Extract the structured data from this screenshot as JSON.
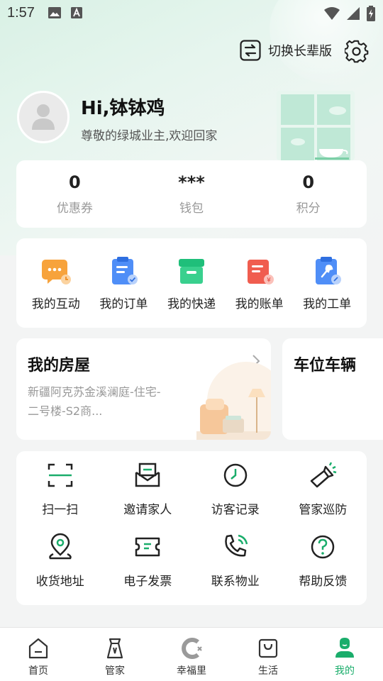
{
  "status_bar": {
    "time": "1:57"
  },
  "header": {
    "switch_label": "切换长辈版"
  },
  "profile": {
    "greeting": "Hi,钵钵鸡",
    "welcome": "尊敬的绿城业主,欢迎回家"
  },
  "stats": [
    {
      "value": "0",
      "label": "优惠券"
    },
    {
      "value": "***",
      "label": "钱包"
    },
    {
      "value": "0",
      "label": "积分"
    }
  ],
  "orders": [
    {
      "label": "我的互动",
      "icon": "chat-icon"
    },
    {
      "label": "我的订单",
      "icon": "order-icon"
    },
    {
      "label": "我的快递",
      "icon": "package-icon"
    },
    {
      "label": "我的账单",
      "icon": "bill-icon"
    },
    {
      "label": "我的工单",
      "icon": "work-order-icon"
    }
  ],
  "house": {
    "title": "我的房屋",
    "address": "新疆阿克苏金溪澜庭-住宅-二号楼-S2商..."
  },
  "vehicle": {
    "title": "车位车辆"
  },
  "services": [
    {
      "label": "扫一扫",
      "icon": "scan-icon"
    },
    {
      "label": "邀请家人",
      "icon": "invite-icon"
    },
    {
      "label": "访客记录",
      "icon": "visitor-clock-icon"
    },
    {
      "label": "管家巡防",
      "icon": "flashlight-icon"
    },
    {
      "label": "收货地址",
      "icon": "location-pin-icon"
    },
    {
      "label": "电子发票",
      "icon": "ticket-icon"
    },
    {
      "label": "联系物业",
      "icon": "phone-icon"
    },
    {
      "label": "帮助反馈",
      "icon": "help-icon"
    }
  ],
  "bottom_nav": [
    {
      "label": "首页",
      "icon": "home-icon"
    },
    {
      "label": "管家",
      "icon": "butler-icon"
    },
    {
      "label": "幸福里",
      "icon": "happiness-icon"
    },
    {
      "label": "生活",
      "icon": "shopping-bag-icon"
    },
    {
      "label": "我的",
      "icon": "profile-icon",
      "active": true
    }
  ],
  "colors": {
    "accent": "#1aad6b",
    "background": "#f3f4f4"
  }
}
